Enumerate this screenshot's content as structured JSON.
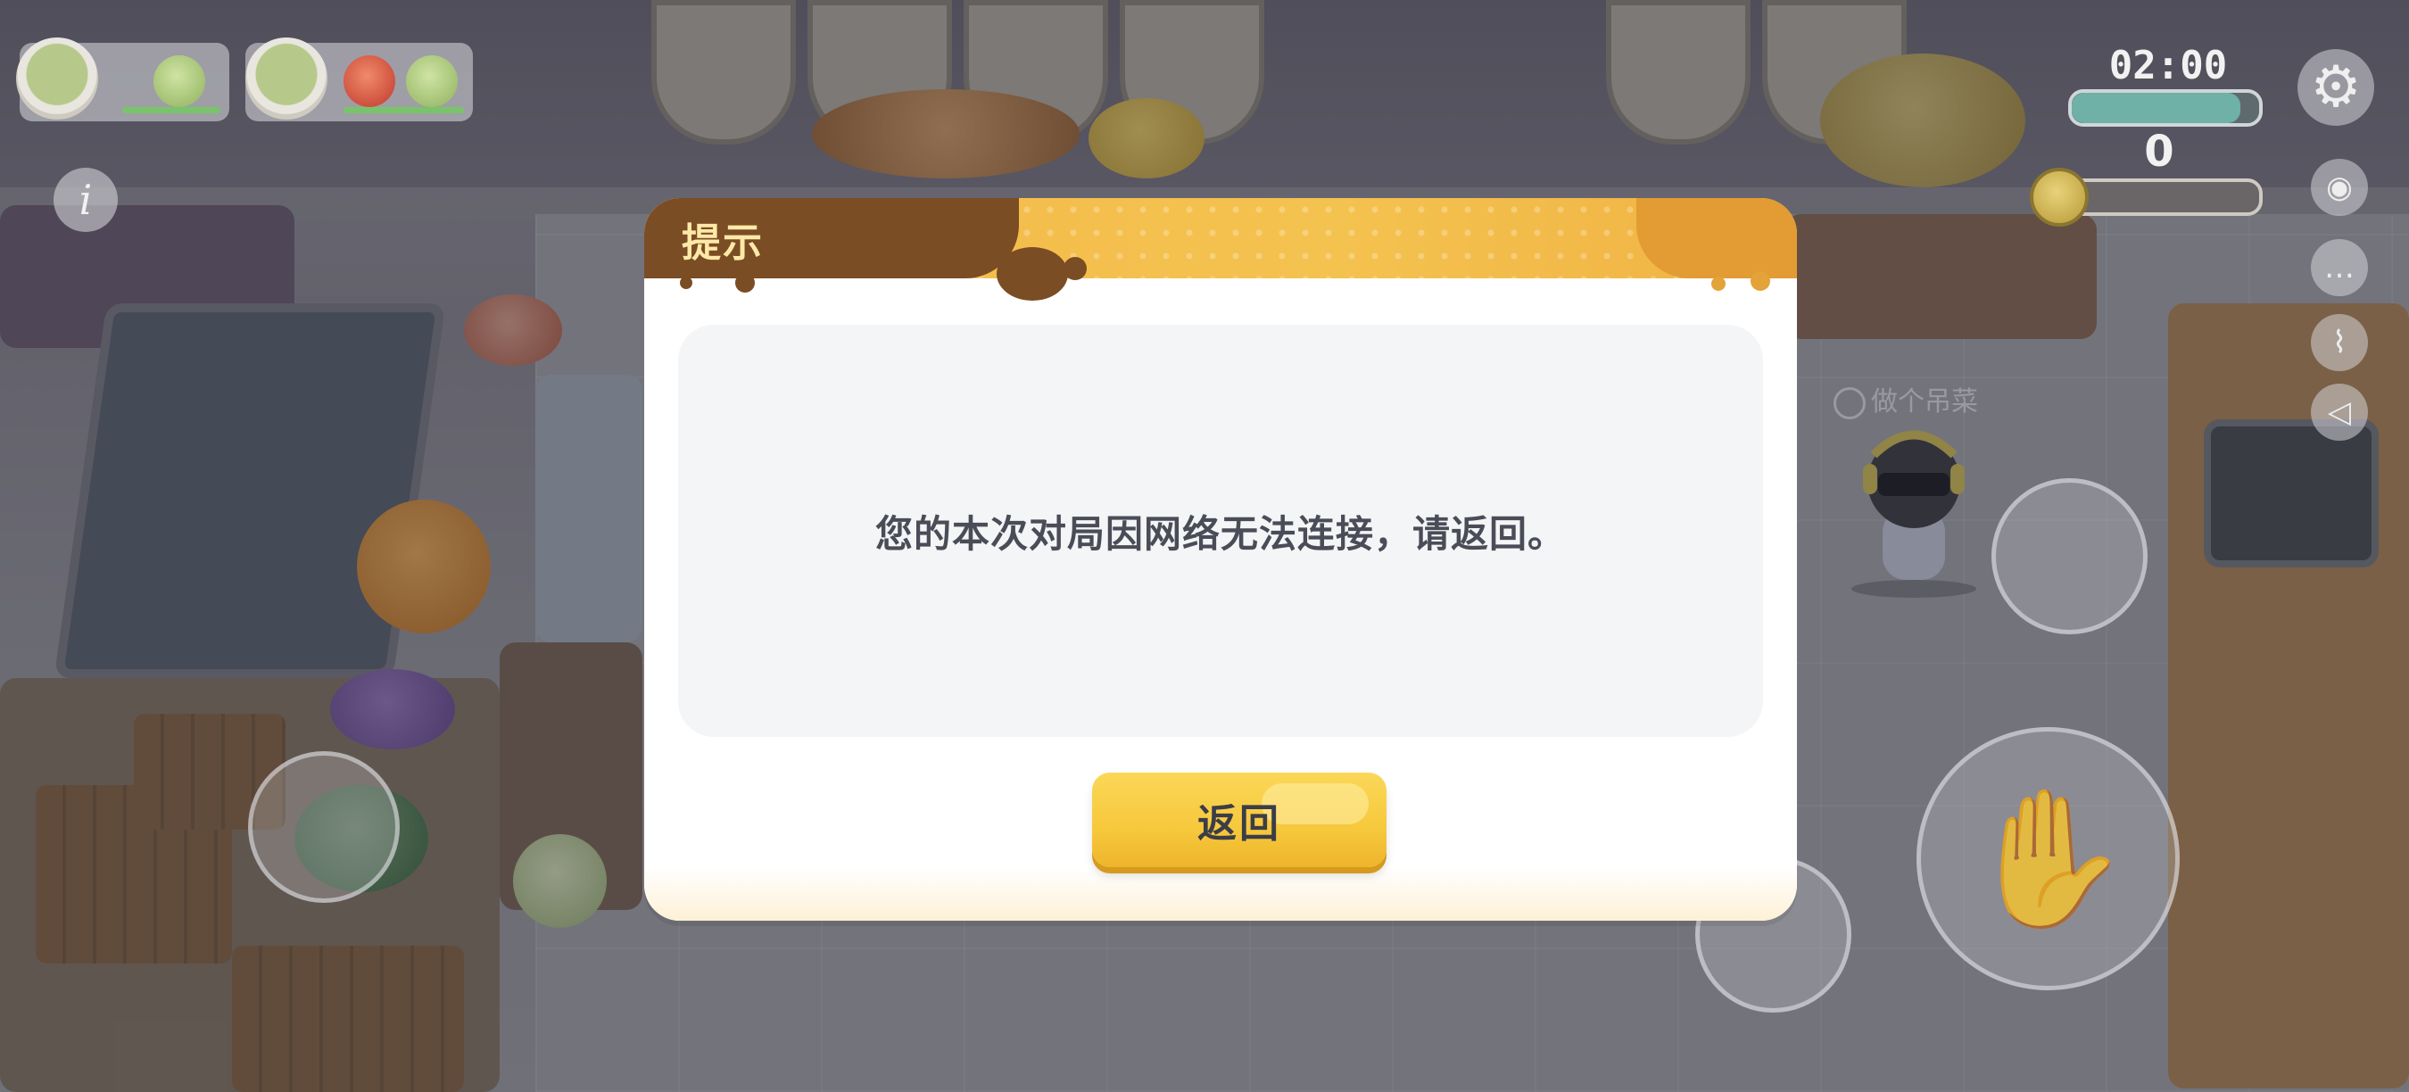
{
  "hud": {
    "timer": "02:00",
    "time_remaining_fraction": 0.9,
    "score": "0",
    "orders": [
      {
        "dish": "salad",
        "ingredients": [
          "lettuce"
        ]
      },
      {
        "dish": "salad",
        "ingredients": [
          "tomato",
          "lettuce"
        ]
      }
    ],
    "buttons": {
      "settings_icon": "gear-icon",
      "info_icon": "info-icon",
      "view_icon": "eye-icon",
      "chat_icon": "chat-icon",
      "mic_icon": "mic-off-icon",
      "sound_icon": "speaker-icon"
    }
  },
  "player": {
    "name_label": "做个吊菜"
  },
  "dialog": {
    "title": "提示",
    "message": "您的本次对局因网络无法连接，请返回。",
    "confirm_label": "返回"
  },
  "colors": {
    "dialog_header_brown": "#7a4d24",
    "dialog_header_yellow": "#f4c24f",
    "button_yellow": "#f6c83c",
    "message_text": "#4a4c57"
  }
}
